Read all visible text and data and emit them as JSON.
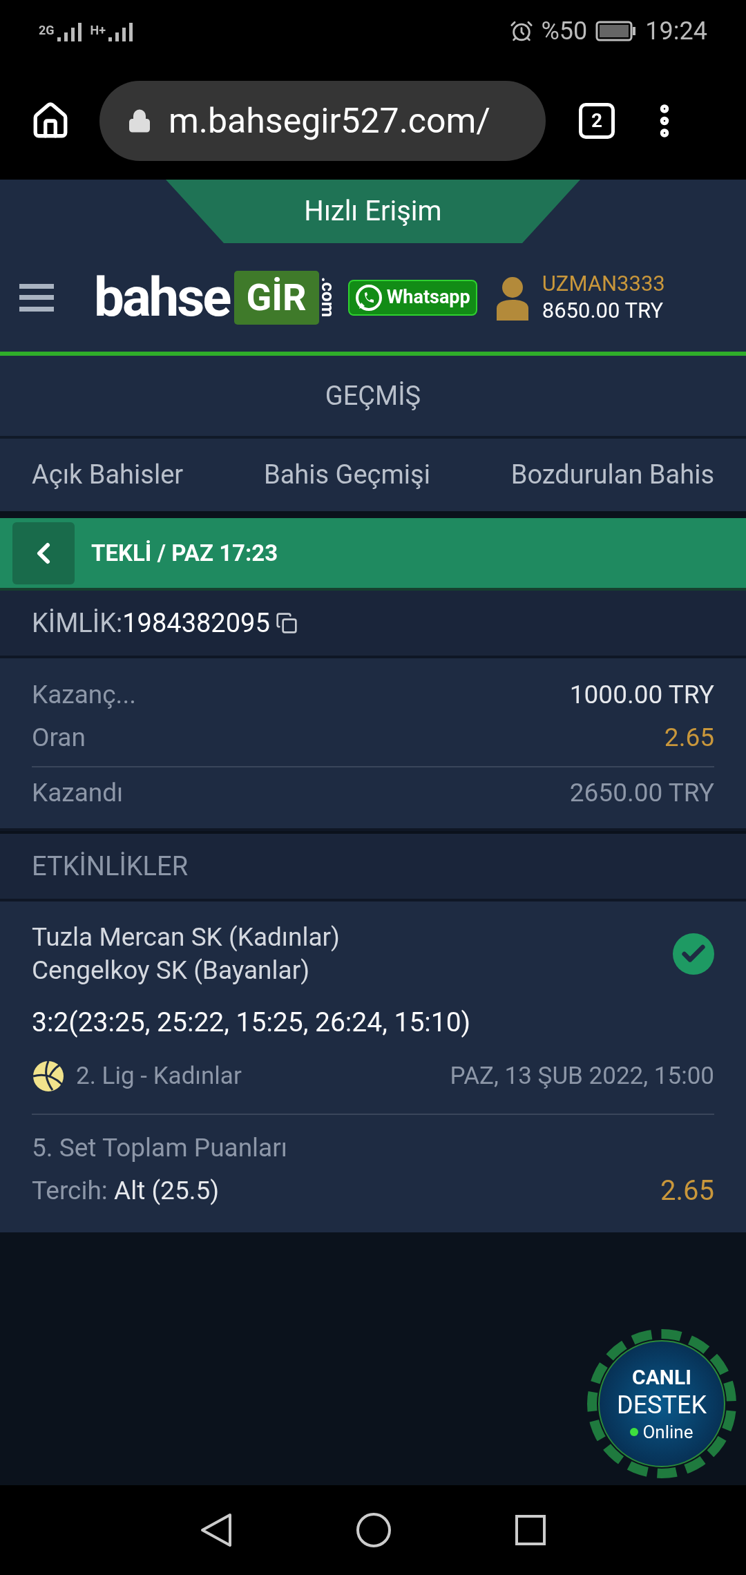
{
  "status_bar": {
    "networks": [
      "2G",
      "H+"
    ],
    "battery": "%50",
    "time": "19:24"
  },
  "browser": {
    "url": "m.bahsegir527.com/",
    "tab_count": "2"
  },
  "quick_access": "Hızlı Erişim",
  "header": {
    "logo": {
      "text": "bahse",
      "badge": "GİR",
      "suffix": ".com"
    },
    "whatsapp": "Whatsapp",
    "user": {
      "name": "UZMAN3333",
      "balance": "8650.00 TRY"
    }
  },
  "page_title": "GEÇMİŞ",
  "tabs": [
    {
      "label": "Açık Bahisler"
    },
    {
      "label": "Bahis Geçmişi"
    },
    {
      "label": "Bozdurulan Bahis"
    }
  ],
  "bet_header": {
    "title": "TEKLİ / PAZ 17:23"
  },
  "bet_id": {
    "label": "KİMLİK:",
    "value": "1984382095"
  },
  "details": [
    {
      "label": "Kazanç...",
      "value": "1000.00 TRY",
      "kind": "stake"
    },
    {
      "label": "Oran",
      "value": "2.65",
      "kind": "odds"
    },
    {
      "label": "Kazandı",
      "value": "2650.00 TRY",
      "kind": "result"
    }
  ],
  "events_title": "ETKİNLİKLER",
  "events": [
    {
      "teams": [
        "Tuzla Mercan SK (Kadınlar)",
        "Cengelkoy SK (Bayanlar)"
      ],
      "won": true,
      "score": "3:2(23:25, 25:22, 15:25, 26:24, 15:10)",
      "league": "2. Lig - Kadınlar",
      "date": "PAZ, 13 ŞUB 2022, 15:00",
      "market": "5. Set Toplam Puanları",
      "choice_label": "Tercih:",
      "choice": "Alt (25.5)",
      "odds": "2.65"
    }
  ],
  "live_support": {
    "lines": [
      "CANLI",
      "DESTEK"
    ],
    "status": "Online"
  }
}
